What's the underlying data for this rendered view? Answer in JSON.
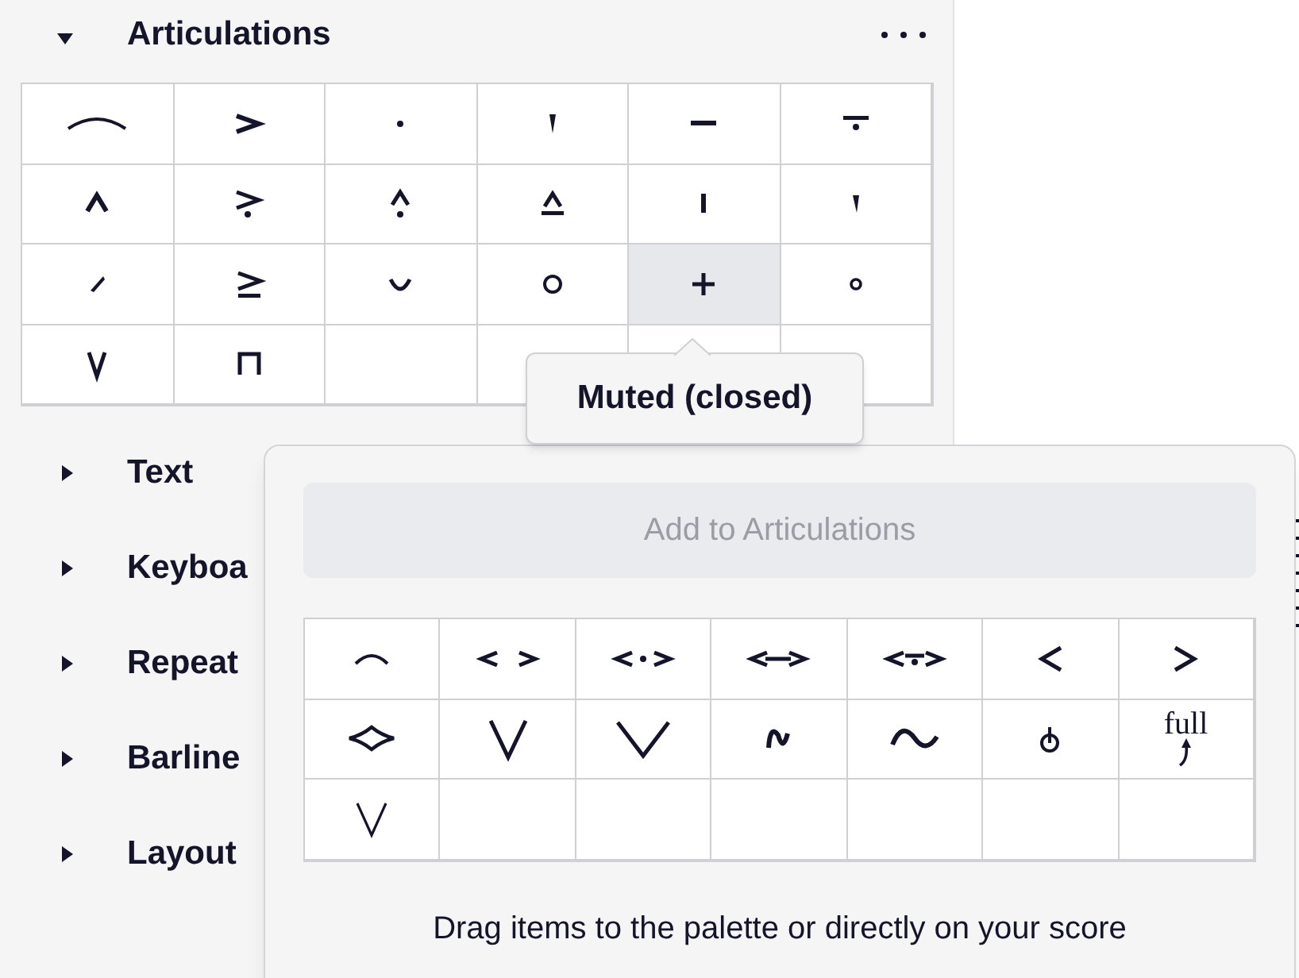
{
  "palette": {
    "title": "Articulations",
    "expanded": true,
    "cells": [
      {
        "kind": "item",
        "highlighted": false
      },
      {
        "kind": "item",
        "highlighted": false
      },
      {
        "kind": "item",
        "highlighted": false
      },
      {
        "kind": "item",
        "highlighted": false
      },
      {
        "kind": "item",
        "highlighted": false
      },
      {
        "kind": "item",
        "highlighted": false
      },
      {
        "kind": "item",
        "highlighted": false
      },
      {
        "kind": "item",
        "highlighted": false
      },
      {
        "kind": "item",
        "highlighted": false
      },
      {
        "kind": "item",
        "highlighted": false
      },
      {
        "kind": "item",
        "highlighted": false
      },
      {
        "kind": "item",
        "highlighted": false
      },
      {
        "kind": "item",
        "highlighted": false
      },
      {
        "kind": "item",
        "highlighted": false
      },
      {
        "kind": "item",
        "highlighted": false
      },
      {
        "kind": "item",
        "highlighted": false
      },
      {
        "kind": "item",
        "highlighted": true
      },
      {
        "kind": "item",
        "highlighted": false
      },
      {
        "kind": "item",
        "highlighted": false
      },
      {
        "kind": "item",
        "highlighted": false
      },
      {
        "kind": "empty",
        "highlighted": false
      },
      {
        "kind": "empty",
        "highlighted": false
      },
      {
        "kind": "empty",
        "highlighted": false
      },
      {
        "kind": "empty",
        "highlighted": false
      }
    ],
    "tooltip": "Muted (closed)"
  },
  "sections": [
    {
      "title": "Text",
      "expanded": false
    },
    {
      "title": "Keyboa",
      "expanded": false
    },
    {
      "title": "Repeat",
      "expanded": false
    },
    {
      "title": "Barline",
      "expanded": false
    },
    {
      "title": "Layout",
      "expanded": false
    }
  ],
  "more_popup": {
    "add_button": {
      "label": "Add to Articulations",
      "disabled": true
    },
    "cells": [
      {
        "kind": "item"
      },
      {
        "kind": "item"
      },
      {
        "kind": "item"
      },
      {
        "kind": "item"
      },
      {
        "kind": "item"
      },
      {
        "kind": "item"
      },
      {
        "kind": "item"
      },
      {
        "kind": "item"
      },
      {
        "kind": "item"
      },
      {
        "kind": "item"
      },
      {
        "kind": "item"
      },
      {
        "kind": "item"
      },
      {
        "kind": "item"
      },
      {
        "kind": "item",
        "label": "full"
      },
      {
        "kind": "item"
      },
      {
        "kind": "empty"
      },
      {
        "kind": "empty"
      },
      {
        "kind": "empty"
      },
      {
        "kind": "empty"
      },
      {
        "kind": "empty"
      },
      {
        "kind": "empty"
      }
    ],
    "hint": "Drag items to the palette or directly on your score"
  }
}
